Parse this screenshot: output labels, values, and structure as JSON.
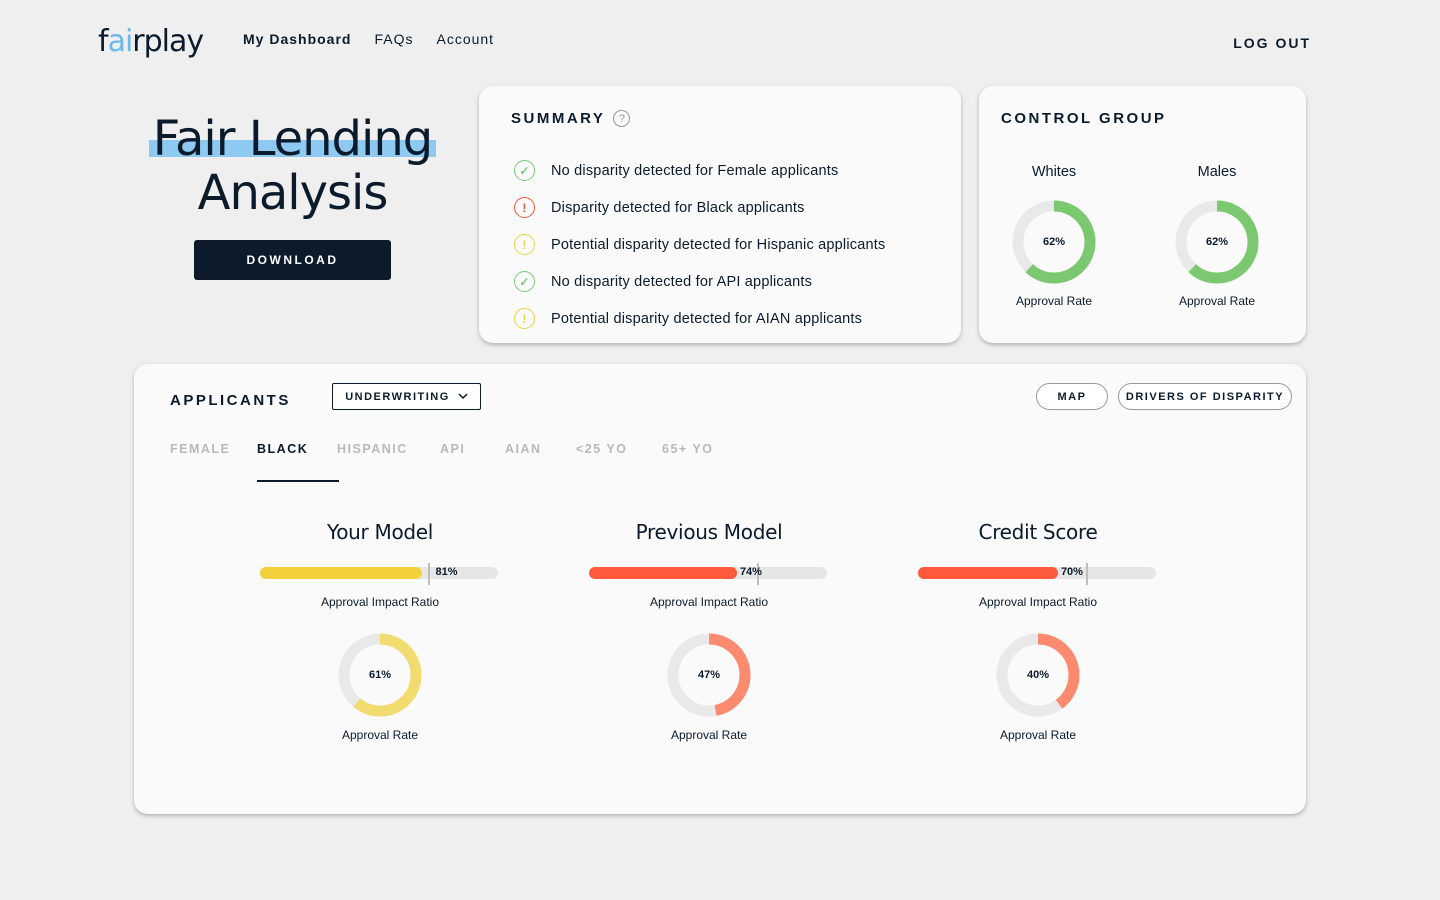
{
  "header": {
    "logo_part1": "f",
    "logo_part2": "ai",
    "logo_part3": "rplay",
    "nav": [
      "My Dashboard",
      "FAQs",
      "Account"
    ],
    "logout": "LOG OUT"
  },
  "hero": {
    "title_line1": "Fair Lending",
    "title_line2": "Analysis",
    "download": "DOWNLOAD"
  },
  "summary": {
    "title": "SUMMARY",
    "items": [
      {
        "status": "ok",
        "text": "No disparity detected for Female applicants"
      },
      {
        "status": "bad",
        "text": "Disparity detected for Black applicants"
      },
      {
        "status": "warn",
        "text": "Potential disparity detected for Hispanic applicants"
      },
      {
        "status": "ok",
        "text": "No disparity detected for API applicants"
      },
      {
        "status": "warn",
        "text": "Potential disparity detected for AIAN applicants"
      }
    ]
  },
  "control_group": {
    "title": "CONTROL GROUP",
    "groups": [
      {
        "name": "Whites",
        "value": 62,
        "label": "62%",
        "sub": "Approval Rate"
      },
      {
        "name": "Males",
        "value": 62,
        "label": "62%",
        "sub": "Approval Rate"
      }
    ]
  },
  "applicants": {
    "title": "APPLICANTS",
    "dropdown": "UNDERWRITING",
    "buttons": {
      "map": "MAP",
      "drivers": "DRIVERS OF DISPARITY"
    },
    "tabs": [
      "FEMALE",
      "BLACK",
      "HISPANIC",
      "API",
      "AIAN",
      "<25 YO",
      "65+ YO"
    ],
    "active_tab": "BLACK",
    "models": [
      {
        "title": "Your Model",
        "air": 81,
        "air_label": "81%",
        "air_sub": "Approval Impact Ratio",
        "rate": 61,
        "rate_label": "61%",
        "rate_sub": "Approval Rate",
        "color": "#f2d13a",
        "donut_color": "#f2dc70"
      },
      {
        "title": "Previous Model",
        "air": 74,
        "air_label": "74%",
        "air_sub": "Approval Impact Ratio",
        "rate": 47,
        "rate_label": "47%",
        "rate_sub": "Approval Rate",
        "color": "#fd5a3c",
        "donut_color": "#fb8a6e"
      },
      {
        "title": "Credit Score",
        "air": 70,
        "air_label": "70%",
        "air_sub": "Approval Impact Ratio",
        "rate": 40,
        "rate_label": "40%",
        "rate_sub": "Approval Rate",
        "color": "#fd5a3c",
        "donut_color": "#fb8a6e"
      }
    ],
    "threshold": 80
  },
  "colors": {
    "ok": "#7cc87c",
    "bad": "#ee5a3a",
    "warn": "#ecd34a",
    "dark": "#0b1b2b",
    "accent": "#8ec9f2",
    "cg_donut": "#7cc870"
  }
}
